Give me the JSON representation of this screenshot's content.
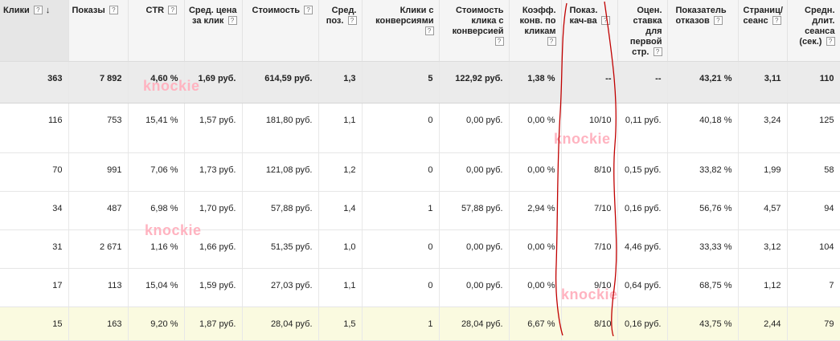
{
  "headers": {
    "clicks": "Клики",
    "impressions": "Показы",
    "ctr": "CTR",
    "avg_cpc": "Сред. цена за клик",
    "cost": "Стоимость",
    "avg_pos": "Сред. поз.",
    "conv_clicks": "Клики с конверсиями",
    "cost_per_conv": "Стоимость клика с конверсией",
    "conv_rate": "Коэфф. конв. по кликам",
    "quality": "Показ. кач-ва",
    "first_page_bid": "Оцен. ставка для первой стр.",
    "bounce_rate": "Показатель отказов",
    "pages_session": "Страниц/ сеанс",
    "avg_session": "Средн. длит. сеанса (сек.)"
  },
  "help_symbol": "?",
  "sort_arrow": "↓",
  "total": [
    "363",
    "7 892",
    "4,60 %",
    "1,69 руб.",
    "614,59 руб.",
    "1,3",
    "5",
    "122,92 руб.",
    "1,38 %",
    "--",
    "--",
    "43,21 %",
    "3,11",
    "110"
  ],
  "rows": [
    [
      "116",
      "753",
      "15,41 %",
      "1,57 руб.",
      "181,80 руб.",
      "1,1",
      "0",
      "0,00 руб.",
      "0,00 %",
      "10/10",
      "0,11 руб.",
      "40,18 %",
      "3,24",
      "125"
    ],
    [
      "70",
      "991",
      "7,06 %",
      "1,73 руб.",
      "121,08 руб.",
      "1,2",
      "0",
      "0,00 руб.",
      "0,00 %",
      "8/10",
      "0,15 руб.",
      "33,82 %",
      "1,99",
      "58"
    ],
    [
      "34",
      "487",
      "6,98 %",
      "1,70 руб.",
      "57,88 руб.",
      "1,4",
      "1",
      "57,88 руб.",
      "2,94 %",
      "7/10",
      "0,16 руб.",
      "56,76 %",
      "4,57",
      "94"
    ],
    [
      "31",
      "2 671",
      "1,16 %",
      "1,66 руб.",
      "51,35 руб.",
      "1,0",
      "0",
      "0,00 руб.",
      "0,00 %",
      "7/10",
      "4,46 руб.",
      "33,33 %",
      "3,12",
      "104"
    ],
    [
      "17",
      "113",
      "15,04 %",
      "1,59 руб.",
      "27,03 руб.",
      "1,1",
      "0",
      "0,00 руб.",
      "0,00 %",
      "9/10",
      "0,64 руб.",
      "68,75 %",
      "1,12",
      "7"
    ],
    [
      "15",
      "163",
      "9,20 %",
      "1,87 руб.",
      "28,04 руб.",
      "1,5",
      "1",
      "28,04 руб.",
      "6,67 %",
      "8/10",
      "0,16 руб.",
      "43,75 %",
      "2,44",
      "79"
    ]
  ],
  "watermark": "knockie",
  "colors": {
    "annotation": "#c00000",
    "watermark": "#ffb3c0",
    "highlight_row": "#fafae0",
    "total_row": "#ebebeb"
  }
}
